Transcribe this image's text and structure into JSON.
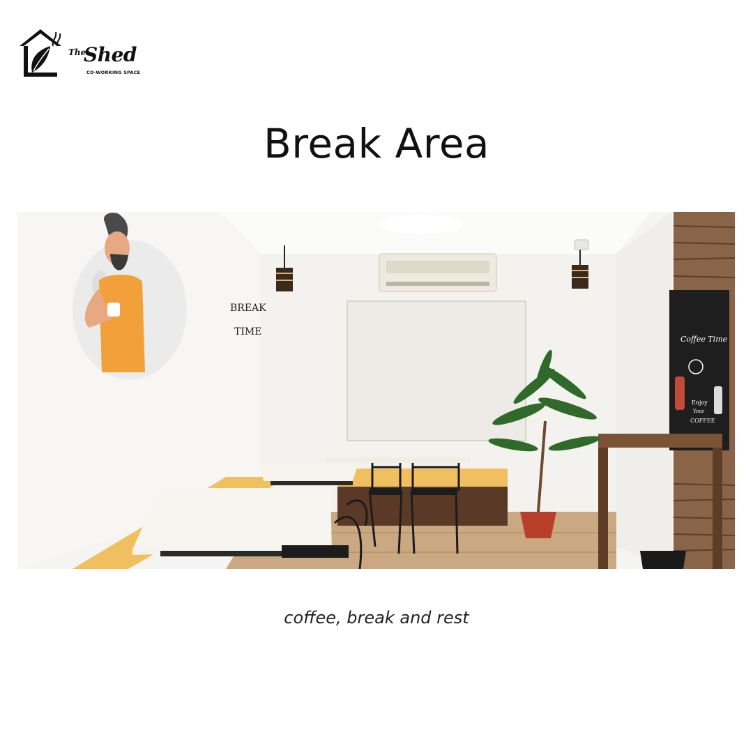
{
  "brand": {
    "name_small": "The",
    "name_large": "Shed",
    "tagline": "CO-WORKING SPACE"
  },
  "heading": "Break Area",
  "photo": {
    "wall_text": [
      "BREAK",
      "TIME"
    ],
    "board_title": "Coffee Time",
    "board_sub": [
      "Enjoy",
      "Your",
      "COFFEE"
    ]
  },
  "caption": "coffee, break and rest"
}
